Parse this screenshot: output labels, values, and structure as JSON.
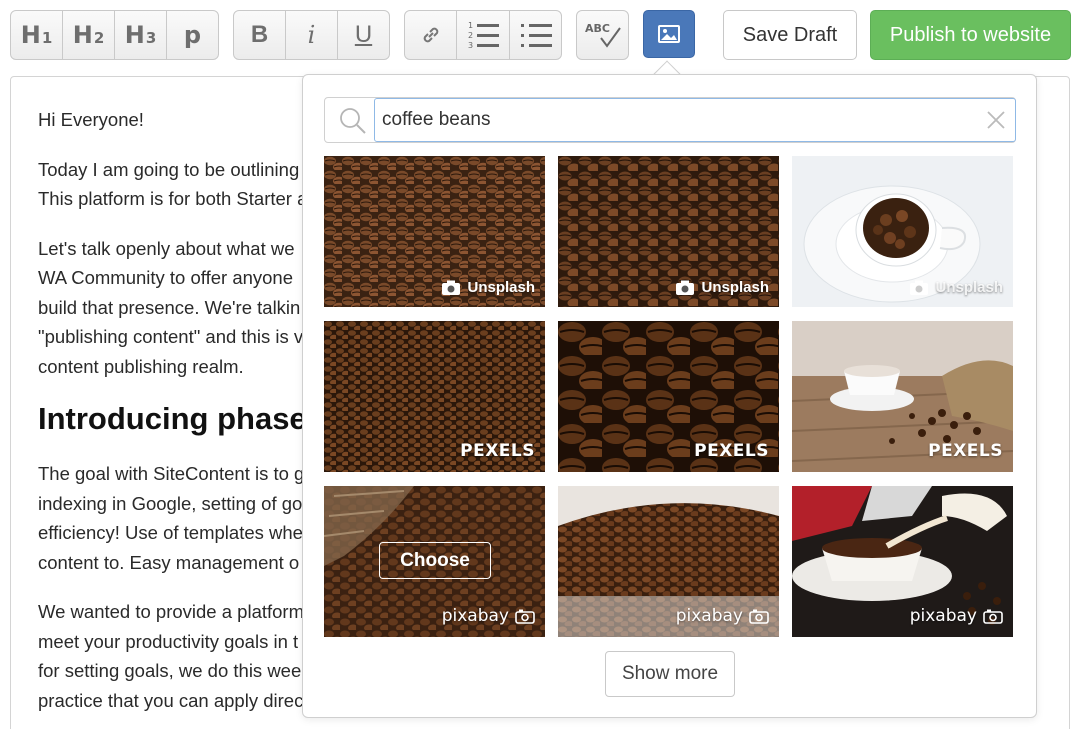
{
  "toolbar": {
    "headings": [
      {
        "main": "H",
        "sub": "1"
      },
      {
        "main": "H",
        "sub": "2"
      },
      {
        "main": "H",
        "sub": "3"
      },
      {
        "main": "p",
        "sub": ""
      }
    ],
    "format": [
      "B",
      "i",
      "U"
    ],
    "save_label": "Save Draft",
    "publish_label": "Publish to website",
    "spellcheck_label": "ABC"
  },
  "editor": {
    "greeting": "Hi Everyone!",
    "p1_line1": "Today I am going to be outlining",
    "p1_line2": "This platform is for both Starter a",
    "p2_line1": "Let's talk openly about what we",
    "p2_line2": "WA Community to offer anyone",
    "p2_line3": "build that presence. We're talkin",
    "p2_line4": "\"publishing content\" and this is v",
    "p2_line5": "content publishing realm.",
    "heading": "Introducing phase",
    "p3_line1": "The goal with SiteContent is to g",
    "p3_line2": "indexing in Google, setting of go",
    "p3_line3": "efficiency! Use of templates whe",
    "p3_line4": "content to. Easy management o",
    "p4_line1": "We wanted to provide a platform",
    "p4_line2": "meet your productivity goals in t",
    "p4_line3": "for setting goals, we do this wee",
    "p4_line4": "practice that you can apply direc"
  },
  "image_search": {
    "query": "coffee beans",
    "results": [
      {
        "credit": "Unsplash",
        "source": "unsplash",
        "subject": "roasted coffee beans close-up"
      },
      {
        "credit": "Unsplash",
        "source": "unsplash",
        "subject": "roasted coffee beans"
      },
      {
        "credit": "Unsplash",
        "source": "unsplash",
        "subject": "white cup full of coffee beans"
      },
      {
        "credit": "PEXELS",
        "source": "pexels",
        "subject": "dense coffee beans"
      },
      {
        "credit": "PEXELS",
        "source": "pexels",
        "subject": "macro coffee beans"
      },
      {
        "credit": "PEXELS",
        "source": "pexels",
        "subject": "coffee cup and burlap sack"
      },
      {
        "credit": "pixabay",
        "source": "pixabay",
        "subject": "coffee beans on sack",
        "hover_label": "Choose"
      },
      {
        "credit": "pixabay",
        "source": "pixabay",
        "subject": "pile of coffee beans"
      },
      {
        "credit": "pixabay",
        "source": "pixabay",
        "subject": "cream poured into coffee"
      }
    ],
    "show_more_label": "Show more"
  },
  "colors": {
    "publish": "#6abf5f",
    "image_button": "#4a78b9",
    "search_focus": "#8fb9e6"
  }
}
